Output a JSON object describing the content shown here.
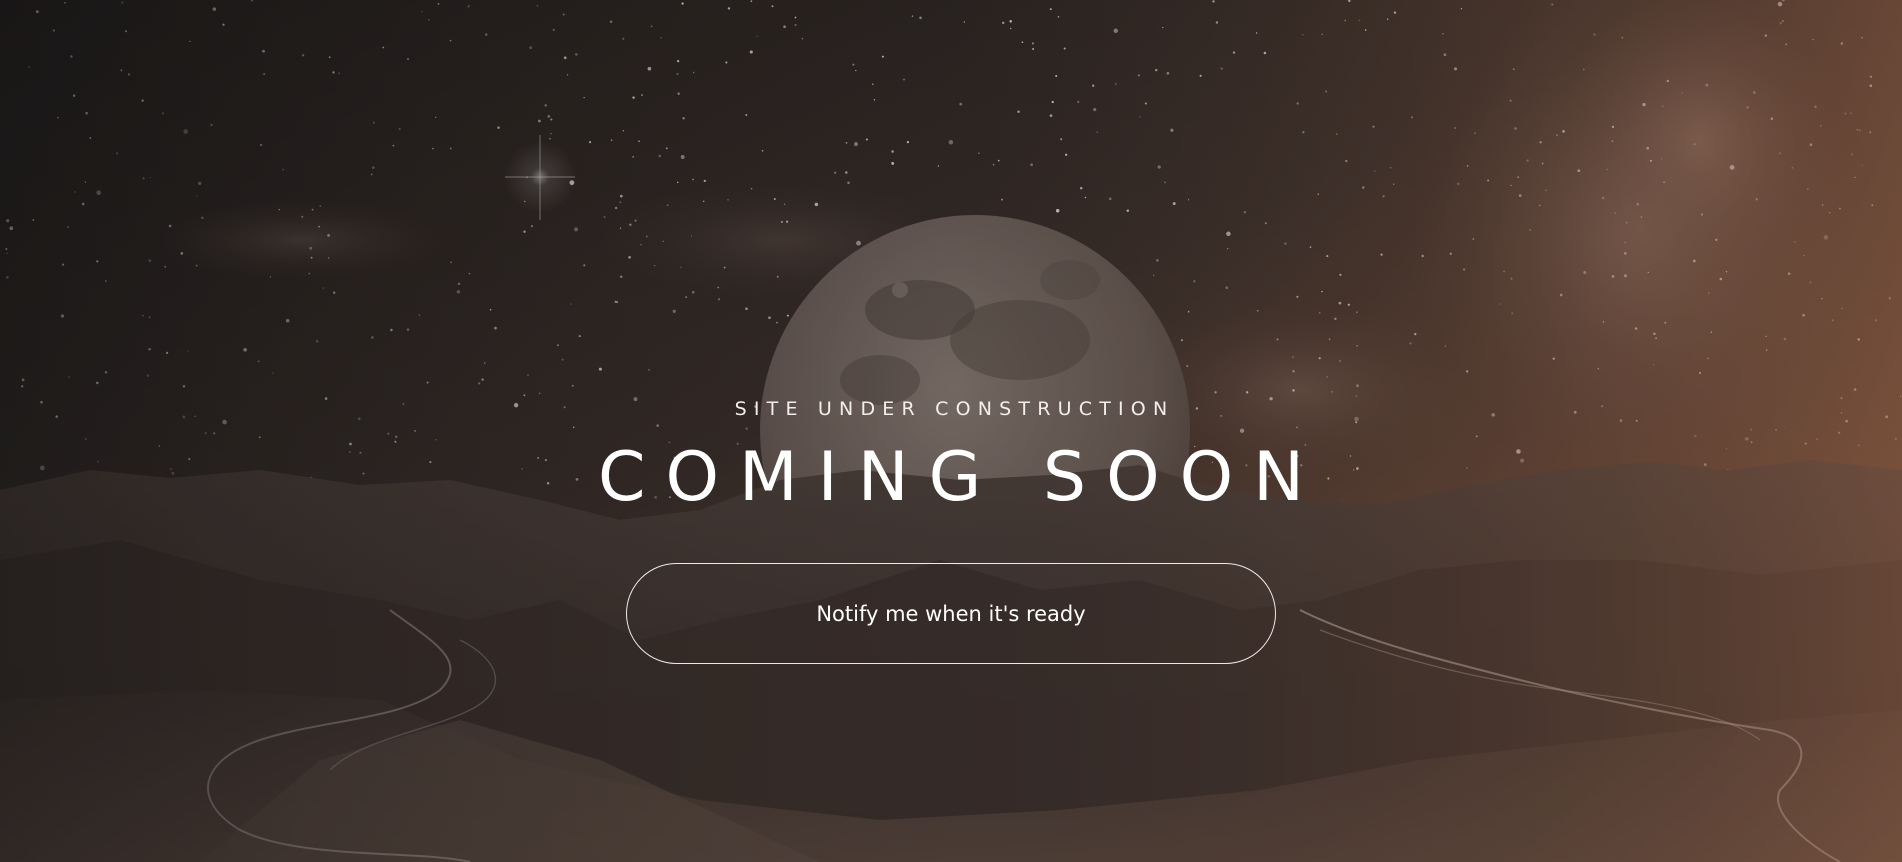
{
  "hero": {
    "subtitle": "SITE UNDER CONSTRUCTION",
    "title": "COMING SOON",
    "notify_label": "Notify me when it's ready"
  },
  "background": {
    "scene": "starry night sky with rising moon over mountain valley with braided rivers",
    "gradient_colors": [
      "#1a1a1a",
      "#4a3a33",
      "#8a5a40"
    ]
  },
  "icons": []
}
